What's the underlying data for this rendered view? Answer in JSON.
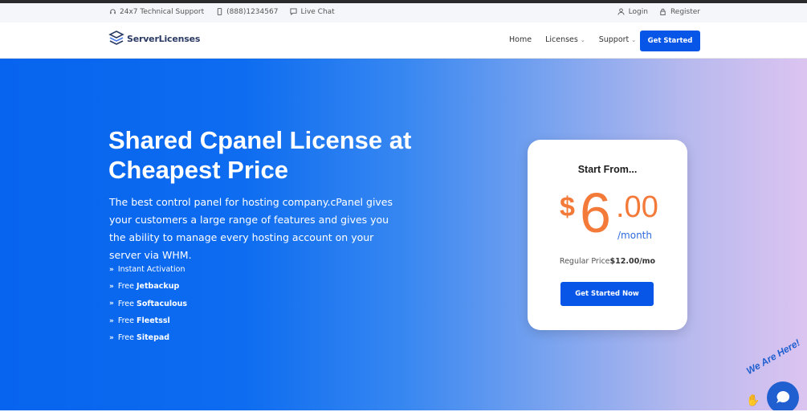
{
  "topbar": {
    "support_label": "24x7 Technical Support",
    "phone": "(888)1234567",
    "live_chat": "Live Chat",
    "login": "Login",
    "register": "Register"
  },
  "navbar": {
    "logo_text": "ServerLicenses",
    "links": {
      "home": "Home",
      "licenses": "Licenses",
      "support": "Support"
    },
    "cta": "Get Started"
  },
  "hero": {
    "title": "Shared Cpanel License at Cheapest Price",
    "description": "The best control panel for hosting company.cPanel gives your customers a large range of features and gives you the ability to manage every hosting account on your server via WHM.",
    "features": [
      {
        "prefix": "Instant Activation",
        "bold": ""
      },
      {
        "prefix": "Free ",
        "bold": "Jetbackup"
      },
      {
        "prefix": "Free ",
        "bold": "Softaculous"
      },
      {
        "prefix": "Free ",
        "bold": "Fleetssl"
      },
      {
        "prefix": "Free ",
        "bold": "Sitepad"
      }
    ]
  },
  "price_card": {
    "heading": "Start From...",
    "currency": "$",
    "integer": "6",
    "decimal": ".00",
    "unit": "/month",
    "regular_label": "Regular Price",
    "regular_value": "$12.00/mo",
    "cta": "Get Started Now"
  },
  "chat_widget": {
    "label": "We Are Here!"
  },
  "colors": {
    "primary": "#0756e8",
    "accent_price": "#f47a3a",
    "hero_start": "#0764ee",
    "hero_end": "#dcc4f0"
  },
  "icons": {
    "support": "headset-icon",
    "phone": "phone-icon",
    "chat": "chat-icon",
    "login": "user-icon",
    "register": "lock-icon",
    "feature": "double-chevron-right-icon"
  }
}
